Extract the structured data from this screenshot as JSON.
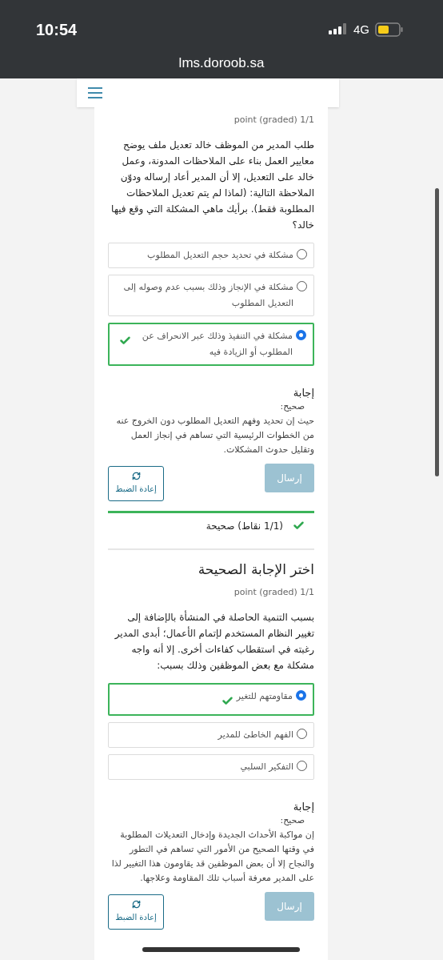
{
  "status_bar": {
    "time": "10:54",
    "network": "4G"
  },
  "browser": {
    "url": "lms.doroob.sa"
  },
  "questions": [
    {
      "points": "point (graded) 1/1",
      "prompt": "طلب المدير من الموظف خالد تعديل ملف يوضح معايير العمل بناء على الملاحظات المدونة، وعمل خالد على التعديل، إلا أن المدير أعاد إرساله ودوّن الملاحظة التالية: (لماذا لم يتم تعديل الملاحظات المطلوبة فقط). برأيك ماهي المشكلة التي وقع فيها خالد؟",
      "options": [
        {
          "label": "مشكلة في تحديد حجم التعديل المطلوب",
          "selected": false,
          "correct": false
        },
        {
          "label": "مشكلة في الإنجاز وذلك بسبب عدم وصوله إلى التعديل المطلوب",
          "selected": false,
          "correct": false
        },
        {
          "label": "مشكلة في التنفيذ وذلك عبر الانحراف عن المطلوب أو الزيادة فيه",
          "selected": true,
          "correct": true
        }
      ],
      "answer": {
        "heading": "إجابة",
        "verdict": "صحيح:",
        "explanation": "حيث إن تحديد وفهم التعديل المطلوب دون الخروج عنه من الخطوات الرئيسية التي تساهم في إنجاز العمل وتقليل حدوث المشكلات."
      },
      "submit": {
        "label": "إرسال",
        "disabled": true
      },
      "reset": {
        "label": "إعادة الضبط"
      },
      "result": {
        "text": "(1/1 نقاط) صحيحة",
        "correct": true
      }
    },
    {
      "title": "اختر الإجابة الصحيحة",
      "points": "point (graded) 1/1",
      "prompt": "بسبب التنمية الحاصلة في المنشأة بالإضافة إلى تغيير النظام المستخدم لإتمام الأعمال؛ أبدى المدير رغبته في استقطاب كفاءات أخرى. إلا أنه واجه مشكلة مع بعض الموظفين وذلك بسبب:",
      "options": [
        {
          "label": "مقاومتهم للتغير",
          "selected": true,
          "correct": true
        },
        {
          "label": "الفهم الخاطئ للمدير",
          "selected": false,
          "correct": false
        },
        {
          "label": "التفكير السلبي",
          "selected": false,
          "correct": false
        }
      ],
      "answer": {
        "heading": "إجابة",
        "verdict": "صحيح:",
        "explanation": "إن مواكبة الأحداث الجديدة وإدخال التعديلات المطلوبة في وقتها الصحيح من الأمور التي تساهم في التطور والنجاح إلا أن بعض الموظفين قد يقاومون هذا التغيير لذا على المدير معرفة أسباب تلك المقاومة وعلاجها."
      },
      "submit": {
        "label": "إرسال",
        "disabled": true
      },
      "reset": {
        "label": "إعادة الضبط"
      }
    }
  ]
}
